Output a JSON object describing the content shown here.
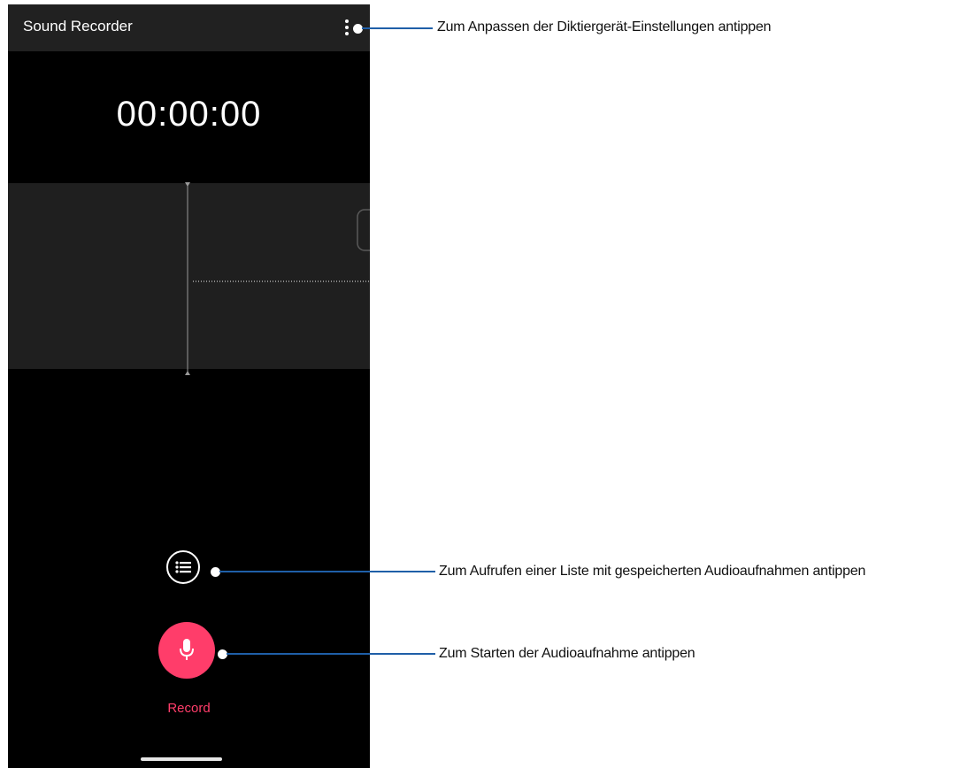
{
  "app": {
    "title": "Sound Recorder",
    "timer": "00:00:00",
    "record_label": "Record",
    "accent_color": "#ff3d6a"
  },
  "icons": {
    "menu": "more-vert-icon",
    "list": "list-icon",
    "mic": "microphone-icon"
  },
  "callouts": {
    "settings": "Zum Anpassen der Diktiergerät-Einstellungen antippen",
    "list": "Zum Aufrufen einer Liste mit gespeicherten Audioaufnahmen antippen",
    "record": "Zum Starten der Audioaufnahme antippen"
  }
}
